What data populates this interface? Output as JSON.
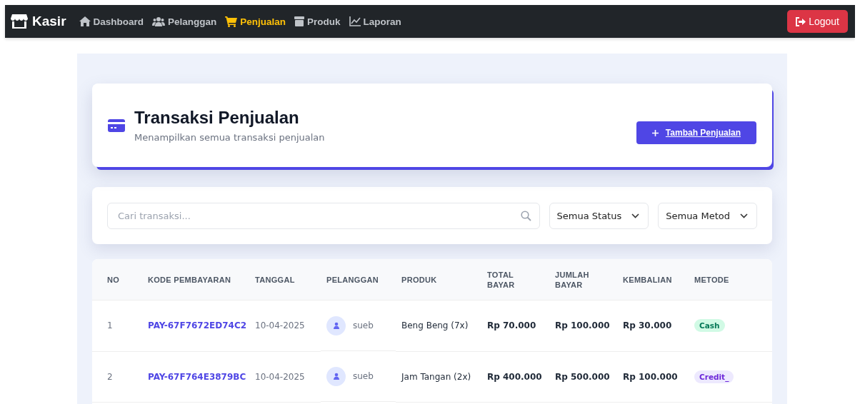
{
  "navbar": {
    "brand": "Kasir",
    "items": [
      {
        "label": "Dashboard",
        "kind": "home",
        "selected": false
      },
      {
        "label": "Pelanggan",
        "kind": "users",
        "selected": false
      },
      {
        "label": "Penjualan",
        "kind": "cart",
        "selected": true
      },
      {
        "label": "Produk",
        "kind": "box",
        "selected": false
      },
      {
        "label": "Laporan",
        "kind": "chart",
        "selected": false
      }
    ],
    "logout": "Logout"
  },
  "header": {
    "title": "Transaksi Penjualan",
    "subtitle": "Menampilkan semua transaksi penjualan",
    "add_button": "Tambah Penjualan"
  },
  "filters": {
    "search": {
      "placeholder": "Cari transaksi..."
    },
    "status": "Semua Status",
    "method": "Semua Metod"
  },
  "table": {
    "columns": [
      "NO",
      "KODE PEMBAYARAN",
      "TANGGAL",
      "PELANGGAN",
      "PRODUK",
      "TOTAL BAYAR",
      "JUMLAH BAYAR",
      "KEMBALIAN",
      "METODE"
    ],
    "rows": [
      {
        "no": "1",
        "code": "PAY-67F7672ED74C2",
        "date": "10-04-2025",
        "customer": "sueb",
        "product": "Beng Beng (7x)",
        "total": "Rp 70.000",
        "paid": "Rp 100.000",
        "change": "Rp 30.000",
        "method": {
          "label": "Cash",
          "color": "#d1fae5"
        }
      },
      {
        "no": "2",
        "code": "PAY-67F764E3879BC",
        "date": "10-04-2025",
        "customer": "sueb",
        "product": "Jam Tangan (2x)",
        "total": "Rp 400.000",
        "paid": "Rp 500.000",
        "change": "Rp 100.000",
        "method": {
          "label": "Credit_",
          "color": "#ede9fe"
        }
      }
    ]
  }
}
